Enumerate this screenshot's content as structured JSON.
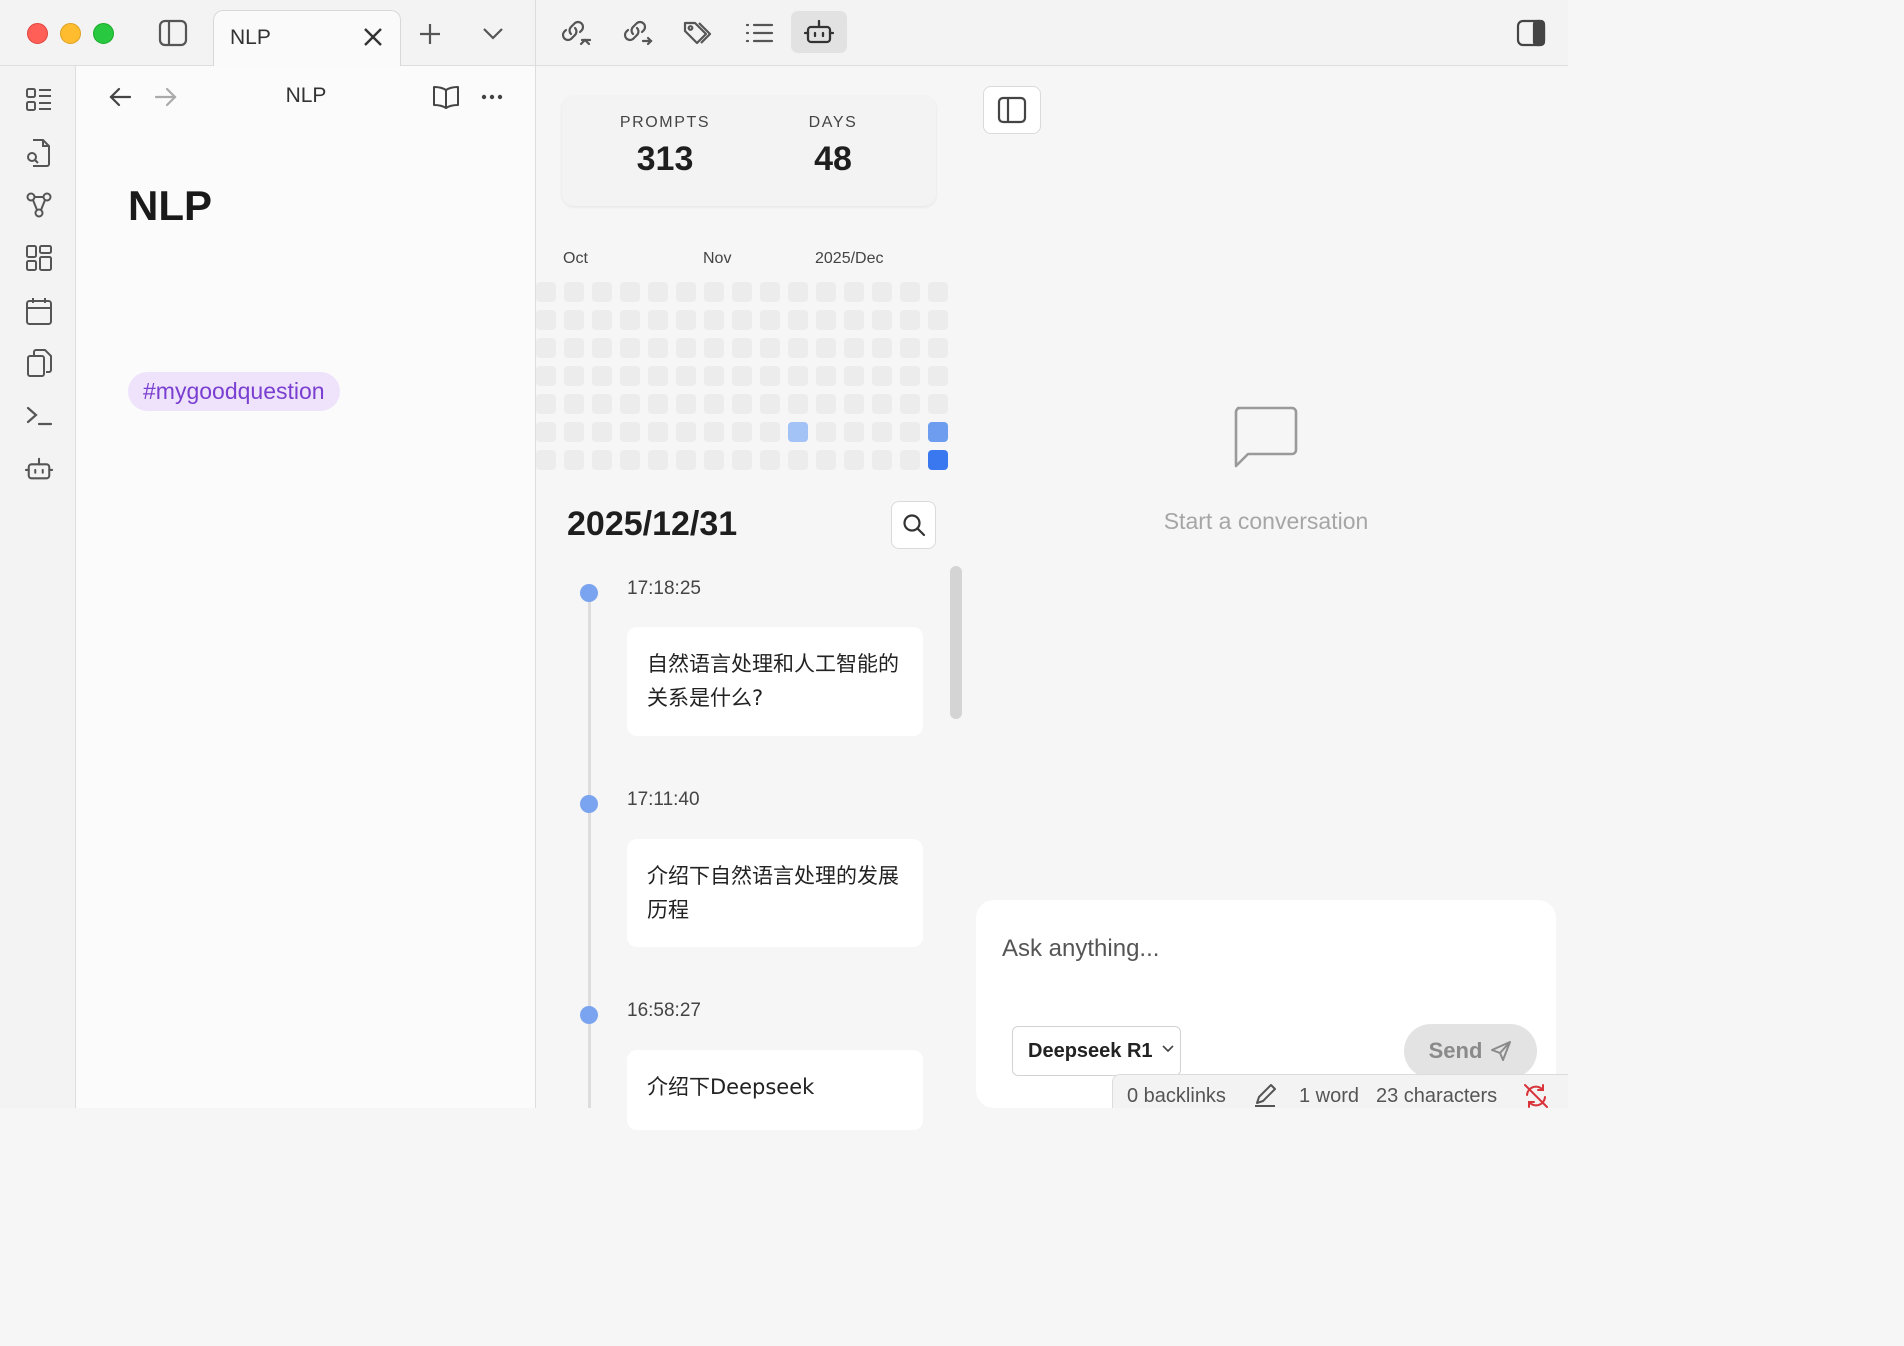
{
  "window": {
    "tab_title": "NLP"
  },
  "note": {
    "header_title": "NLP",
    "title": "NLP",
    "tag": "#mygoodquestion"
  },
  "stats": {
    "prompts_label": "PROMPTS",
    "prompts_value": "313",
    "days_label": "DAYS",
    "days_value": "48"
  },
  "heatmap": {
    "months": [
      "Oct",
      "Nov",
      "2025/Dec"
    ],
    "rows": 7,
    "cols": 15,
    "active_cells": [
      {
        "row": 5,
        "col": 9,
        "level": 1
      },
      {
        "row": 5,
        "col": 14,
        "level": 2
      },
      {
        "row": 6,
        "col": 14,
        "level": 3
      }
    ],
    "level_colors": [
      "#ececec",
      "#a3c3f6",
      "#6e9df0",
      "#3a78ef"
    ]
  },
  "timeline": {
    "date": "2025/12/31",
    "entries": [
      {
        "time": "17:18:25",
        "text": "自然语言处理和人工智能的关系是什么?"
      },
      {
        "time": "17:11:40",
        "text": "介绍下自然语言处理的发展历程"
      },
      {
        "time": "16:58:27",
        "text": "介绍下Deepseek"
      }
    ]
  },
  "chat": {
    "empty_text": "Start a conversation",
    "placeholder": "Ask anything...",
    "model": "Deepseek R1",
    "send_label": "Send"
  },
  "statusbar": {
    "backlinks": "0 backlinks",
    "words": "1 word",
    "characters": "23 characters"
  },
  "colors": {
    "accent_blue": "#3a78ef",
    "tag_text": "#7a3fd0",
    "tag_bg": "#eee3fb",
    "sync_error": "#d9343a"
  }
}
